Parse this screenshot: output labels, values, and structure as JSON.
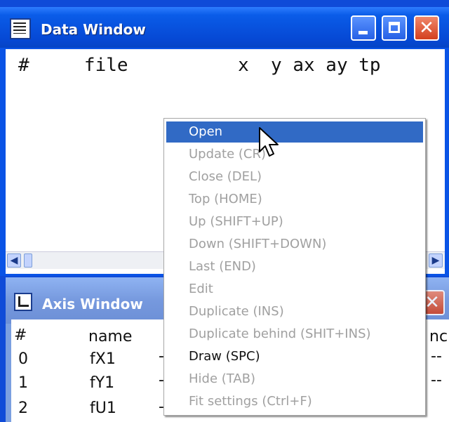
{
  "data_window": {
    "title": "Data Window",
    "header": "#     file          x  y ax ay tp",
    "minimize_label": "minimize",
    "maximize_label": "maximize",
    "close_label": "close"
  },
  "axis_window": {
    "title": "Axis Window",
    "header_num": "#",
    "header_name": "name",
    "header_tail": "nc",
    "rows": [
      {
        "num": "0",
        "name": "fX1"
      },
      {
        "num": "1",
        "name": "fY1"
      },
      {
        "num": "2",
        "name": "fU1"
      }
    ]
  },
  "context_menu": {
    "items": [
      {
        "label": "Open",
        "enabled": true,
        "highlighted": true
      },
      {
        "label": "Update (CR)",
        "enabled": false
      },
      {
        "label": "Close (DEL)",
        "enabled": false
      },
      {
        "label": "Top (HOME)",
        "enabled": false
      },
      {
        "label": "Up (SHIFT+UP)",
        "enabled": false
      },
      {
        "label": "Down (SHIFT+DOWN)",
        "enabled": false
      },
      {
        "label": "Last (END)",
        "enabled": false
      },
      {
        "label": "Edit",
        "enabled": false
      },
      {
        "label": "Duplicate (INS)",
        "enabled": false
      },
      {
        "label": "Duplicate behind (SHIT+INS)",
        "enabled": false
      },
      {
        "label": "Draw (SPC)",
        "enabled": true
      },
      {
        "label": "Hide (TAB)",
        "enabled": false
      },
      {
        "label": "Fit settings (Ctrl+F)",
        "enabled": false
      }
    ]
  },
  "colors": {
    "titlebar_active": "#0a5ce8",
    "titlebar_inactive": "#7b9fe0",
    "menu_highlight": "#316ac5",
    "disabled_text": "#a0a0a0"
  }
}
